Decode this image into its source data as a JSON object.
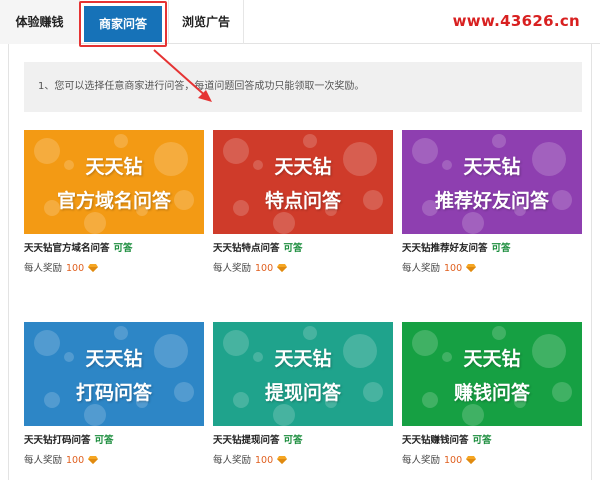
{
  "tabs": [
    {
      "label": "体验赚钱"
    },
    {
      "label": "商家问答"
    },
    {
      "label": "浏览广告"
    }
  ],
  "site_url": "www.43626.cn",
  "notice": "1、您可以选择任意商家进行问答，每道问题回答成功只能领取一次奖励。",
  "cards": [
    {
      "line1": "天天钻",
      "line2": "官方域名问答",
      "title": "天天钻官方域名问答",
      "status": "可答",
      "reward_label": "每人奖励",
      "reward": "100",
      "color": "#f39a14"
    },
    {
      "line1": "天天钻",
      "line2": "特点问答",
      "title": "天天钻特点问答",
      "status": "可答",
      "reward_label": "每人奖励",
      "reward": "100",
      "color": "#cf3b2a"
    },
    {
      "line1": "天天钻",
      "line2": "推荐好友问答",
      "title": "天天钻推荐好友问答",
      "status": "可答",
      "reward_label": "每人奖励",
      "reward": "100",
      "color": "#8e3fb0"
    },
    {
      "line1": "天天钻",
      "line2": "打码问答",
      "title": "天天钻打码问答",
      "status": "可答",
      "reward_label": "每人奖励",
      "reward": "100",
      "color": "#2d86c6"
    },
    {
      "line1": "天天钻",
      "line2": "提现问答",
      "title": "天天钻提现问答",
      "status": "可答",
      "reward_label": "每人奖励",
      "reward": "100",
      "color": "#1fa38c"
    },
    {
      "line1": "天天钻",
      "line2": "赚钱问答",
      "title": "天天钻赚钱问答",
      "status": "可答",
      "reward_label": "每人奖励",
      "reward": "100",
      "color": "#16a043"
    }
  ],
  "colors": {
    "active_tab": "#1672b8",
    "highlight": "#e53333",
    "status_ok": "#1a8c3c",
    "reward_num": "#e06020",
    "gem": "#f5a623"
  },
  "icons": {
    "reward": "diamond-icon",
    "pointer": "arrow-icon"
  }
}
